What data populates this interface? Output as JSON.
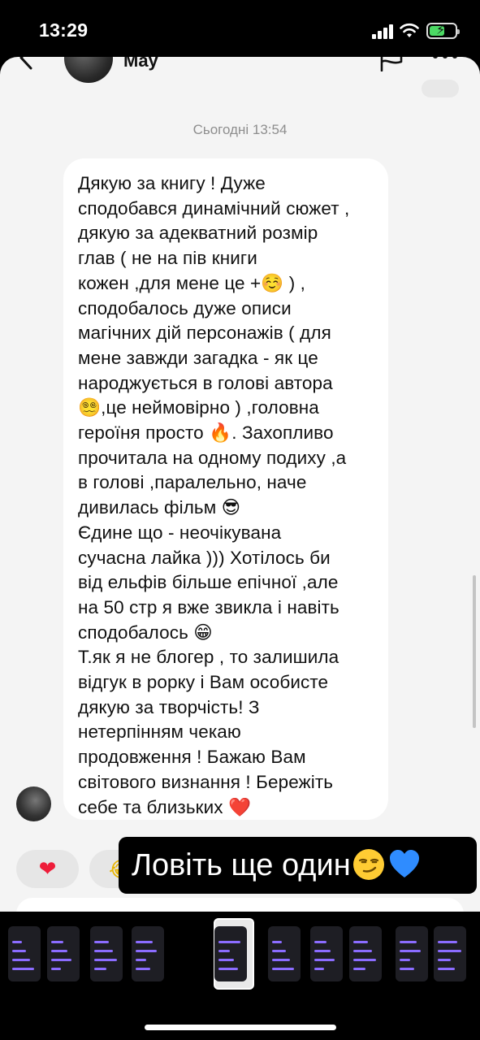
{
  "status_bar": {
    "time": "13:29",
    "icons": [
      "signal-icon",
      "wifi-icon",
      "battery-charging-icon"
    ],
    "battery_level": 0.6
  },
  "chat": {
    "contact_name": "May",
    "header_icons": [
      "back-icon",
      "flag-icon",
      "more-icon"
    ],
    "timestamp": "Сьогодні 13:54",
    "message_lines": [
      "Дякую за книгу ! Дуже",
      "сподобався динамічний сюжет ,",
      "дякую за адекватний розмір",
      "глав ( не на пів книги",
      "кожен ,для мене це +☺️ ) ,",
      "сподобалось дуже описи",
      "магічних дій персонажів ( для",
      "мене завжди загадка - як це",
      "народжується в голові автора",
      "😵‍💫,це неймовірно ) ,головна",
      "героїня просто 🔥. Захопливо",
      "прочитала на одному подиху ,а",
      "в голові ,паралельно, наче",
      "дивилась фільм 😎",
      "Єдине що - неочікувана",
      "сучасна лайка ))) Хотілось би",
      "від ельфів більше епічної ,але",
      "на 50 стр я вже звикла і навіть",
      "сподобалось 😁",
      "Т.як я не блогер , то залишила",
      "відгук в рорку і Вам особисте",
      "дякую за творчість! З",
      "нетерпінням чекаю",
      "продовження ! Бажаю Вам",
      "світового визнання ! Бережіть",
      "себе та близьких ❤️"
    ],
    "reactions": [
      {
        "icon": "heart-icon",
        "glyph": "❤"
      },
      {
        "icon": "laughing-face-icon",
        "glyph": "😂"
      }
    ]
  },
  "story": {
    "caption": "Ловіть ще один",
    "caption_emojis": [
      "smirking-face-icon",
      "blue-heart-icon"
    ]
  },
  "thumbnails": {
    "count": 11,
    "active_index": 4
  },
  "colors": {
    "heart": "#ee1d3a",
    "accent_purple": "#8b6cff",
    "caption_bg": "#000000"
  }
}
